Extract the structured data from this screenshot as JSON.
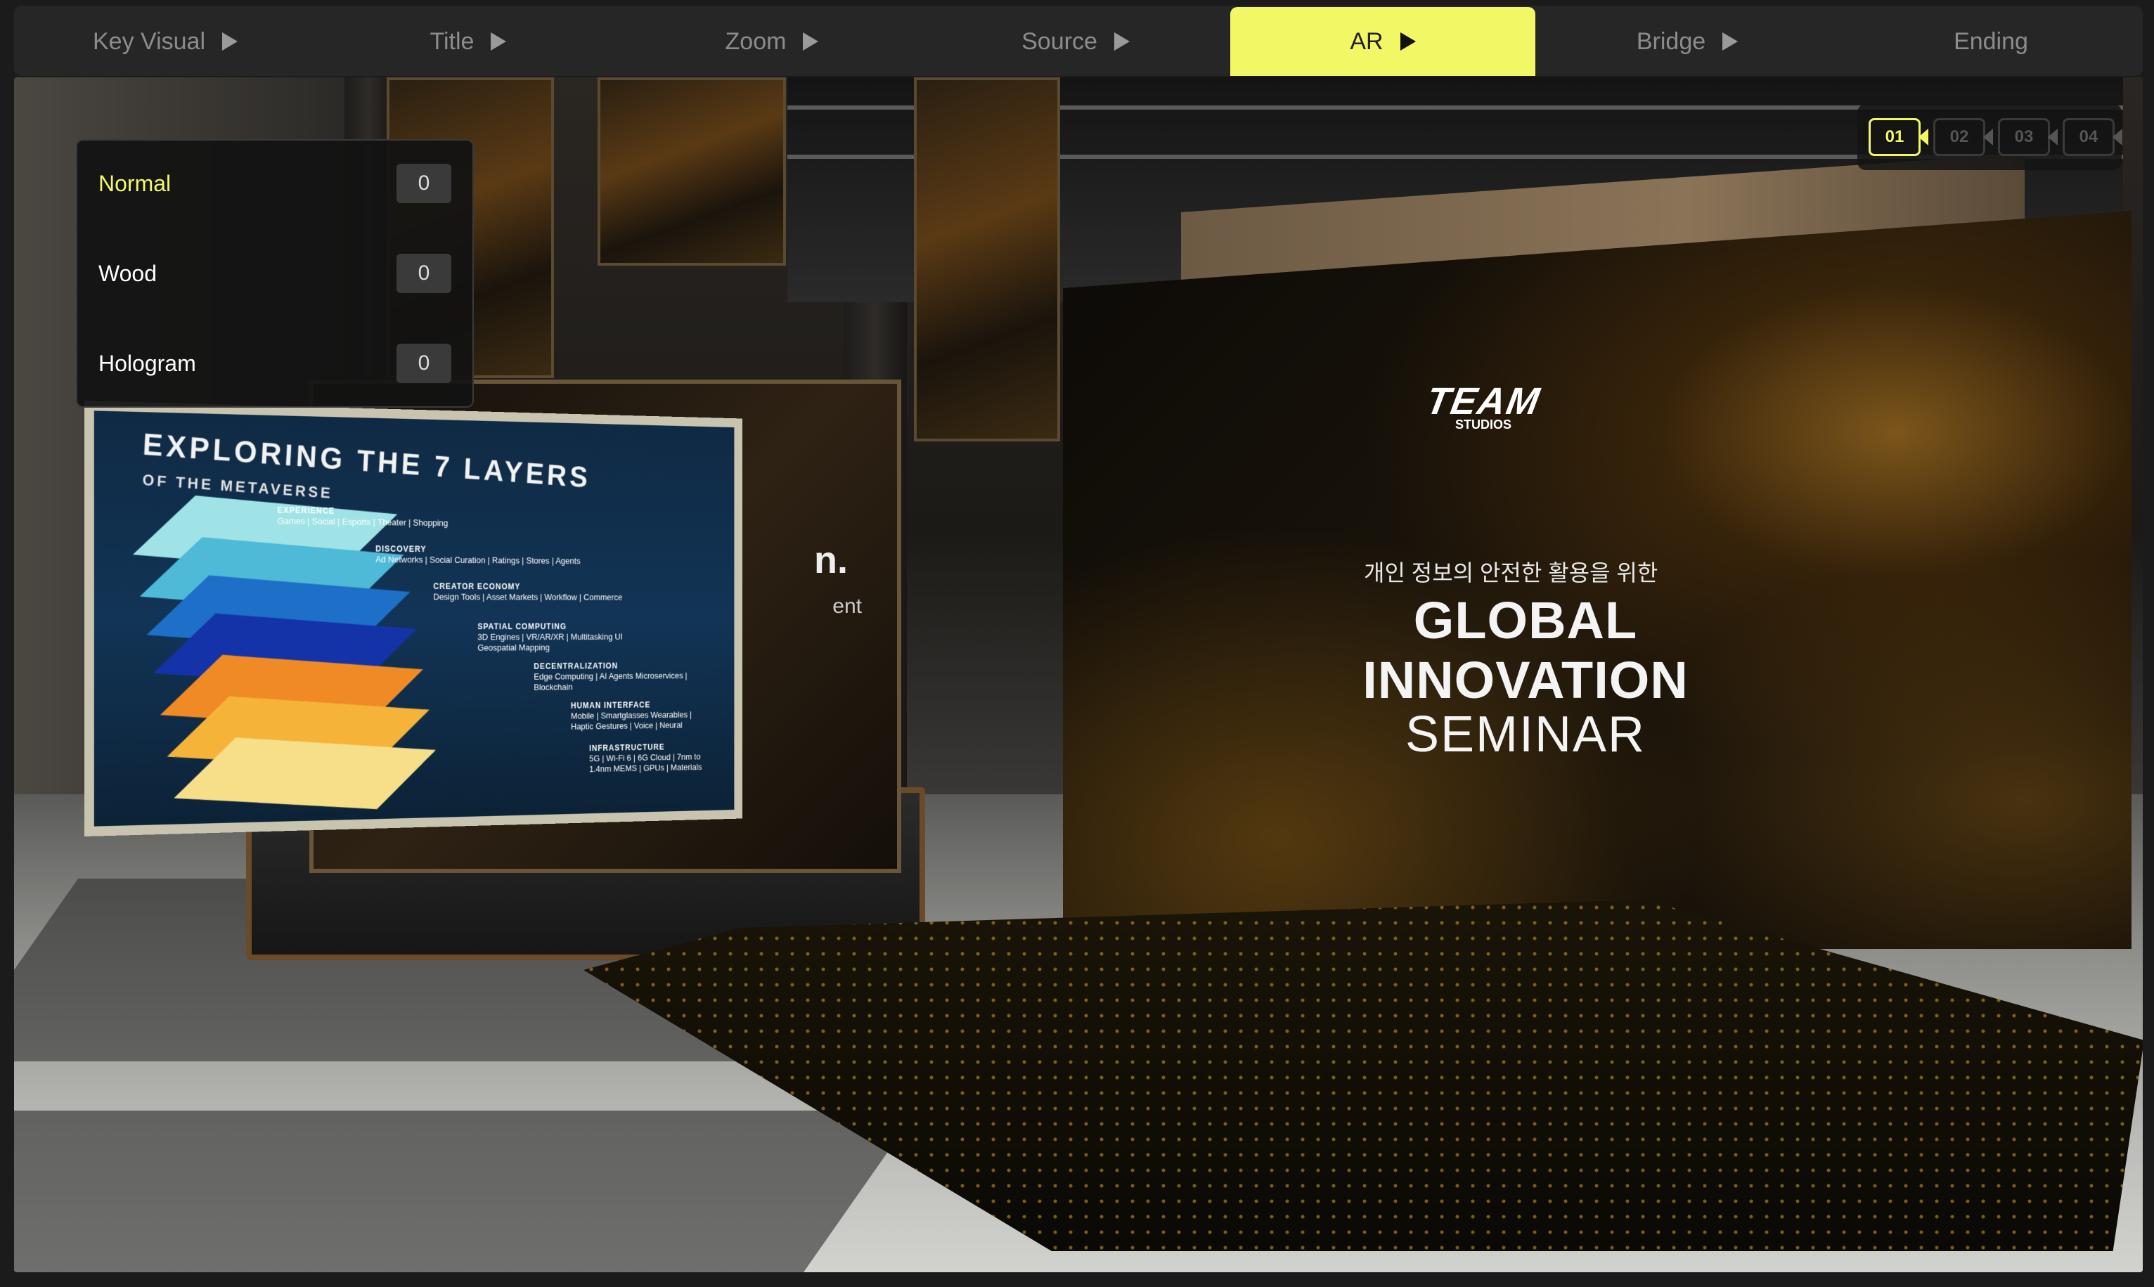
{
  "tabs": [
    {
      "label": "Key Visual",
      "has_play": true,
      "active": false
    },
    {
      "label": "Title",
      "has_play": true,
      "active": false
    },
    {
      "label": "Zoom",
      "has_play": true,
      "active": false
    },
    {
      "label": "Source",
      "has_play": true,
      "active": false
    },
    {
      "label": "AR",
      "has_play": true,
      "active": true
    },
    {
      "label": "Bridge",
      "has_play": true,
      "active": false
    },
    {
      "label": "Ending",
      "has_play": false,
      "active": false
    }
  ],
  "material_panel": {
    "items": [
      {
        "label": "Normal",
        "value": "0",
        "selected": true
      },
      {
        "label": "Wood",
        "value": "0",
        "selected": false
      },
      {
        "label": "Hologram",
        "value": "0",
        "selected": false
      }
    ]
  },
  "cameras": [
    {
      "label": "01",
      "active": true
    },
    {
      "label": "02",
      "active": false
    },
    {
      "label": "03",
      "active": false
    },
    {
      "label": "04",
      "active": false
    }
  ],
  "scene": {
    "main_screen": {
      "logo": "TEAM",
      "logo_sub": "STUDIOS",
      "korean_subtitle": "개인 정보의 안전한 활용을 위한",
      "title_line1": "GLOBAL INNOVATION",
      "title_line2": "SEMINAR"
    },
    "back_screen": {
      "text1": "n.",
      "text2": "ent"
    },
    "front_screen": {
      "title": "EXPLORING THE 7 LAYERS",
      "subtitle": "OF THE METAVERSE",
      "layers": [
        {
          "name": "EXPERIENCE",
          "items": "Games | Social | Esports | Theater | Shopping"
        },
        {
          "name": "DISCOVERY",
          "items": "Ad Networks | Social Curation | Ratings | Stores | Agents"
        },
        {
          "name": "CREATOR ECONOMY",
          "items": "Design Tools | Asset Markets | Workflow | Commerce"
        },
        {
          "name": "SPATIAL COMPUTING",
          "items": "3D Engines | VR/AR/XR | Multitasking UI Geospatial Mapping"
        },
        {
          "name": "DECENTRALIZATION",
          "items": "Edge Computing | AI Agents Microservices | Blockchain"
        },
        {
          "name": "HUMAN INTERFACE",
          "items": "Mobile | Smartglasses Wearables | Haptic Gestures | Voice | Neural"
        },
        {
          "name": "INFRASTRUCTURE",
          "items": "5G | Wi-Fi 6 | 6G Cloud | 7nm to 1.4nm MEMS | GPUs | Materials"
        }
      ]
    }
  },
  "colors": {
    "accent": "#f2f766",
    "panel_bg": "#121212",
    "tab_bar_bg": "#262626",
    "layer_colors": [
      "#9fe3e6",
      "#4fb9d8",
      "#1d6fc8",
      "#1433a8",
      "#f08a24",
      "#f5b33a",
      "#f7df8a"
    ]
  }
}
